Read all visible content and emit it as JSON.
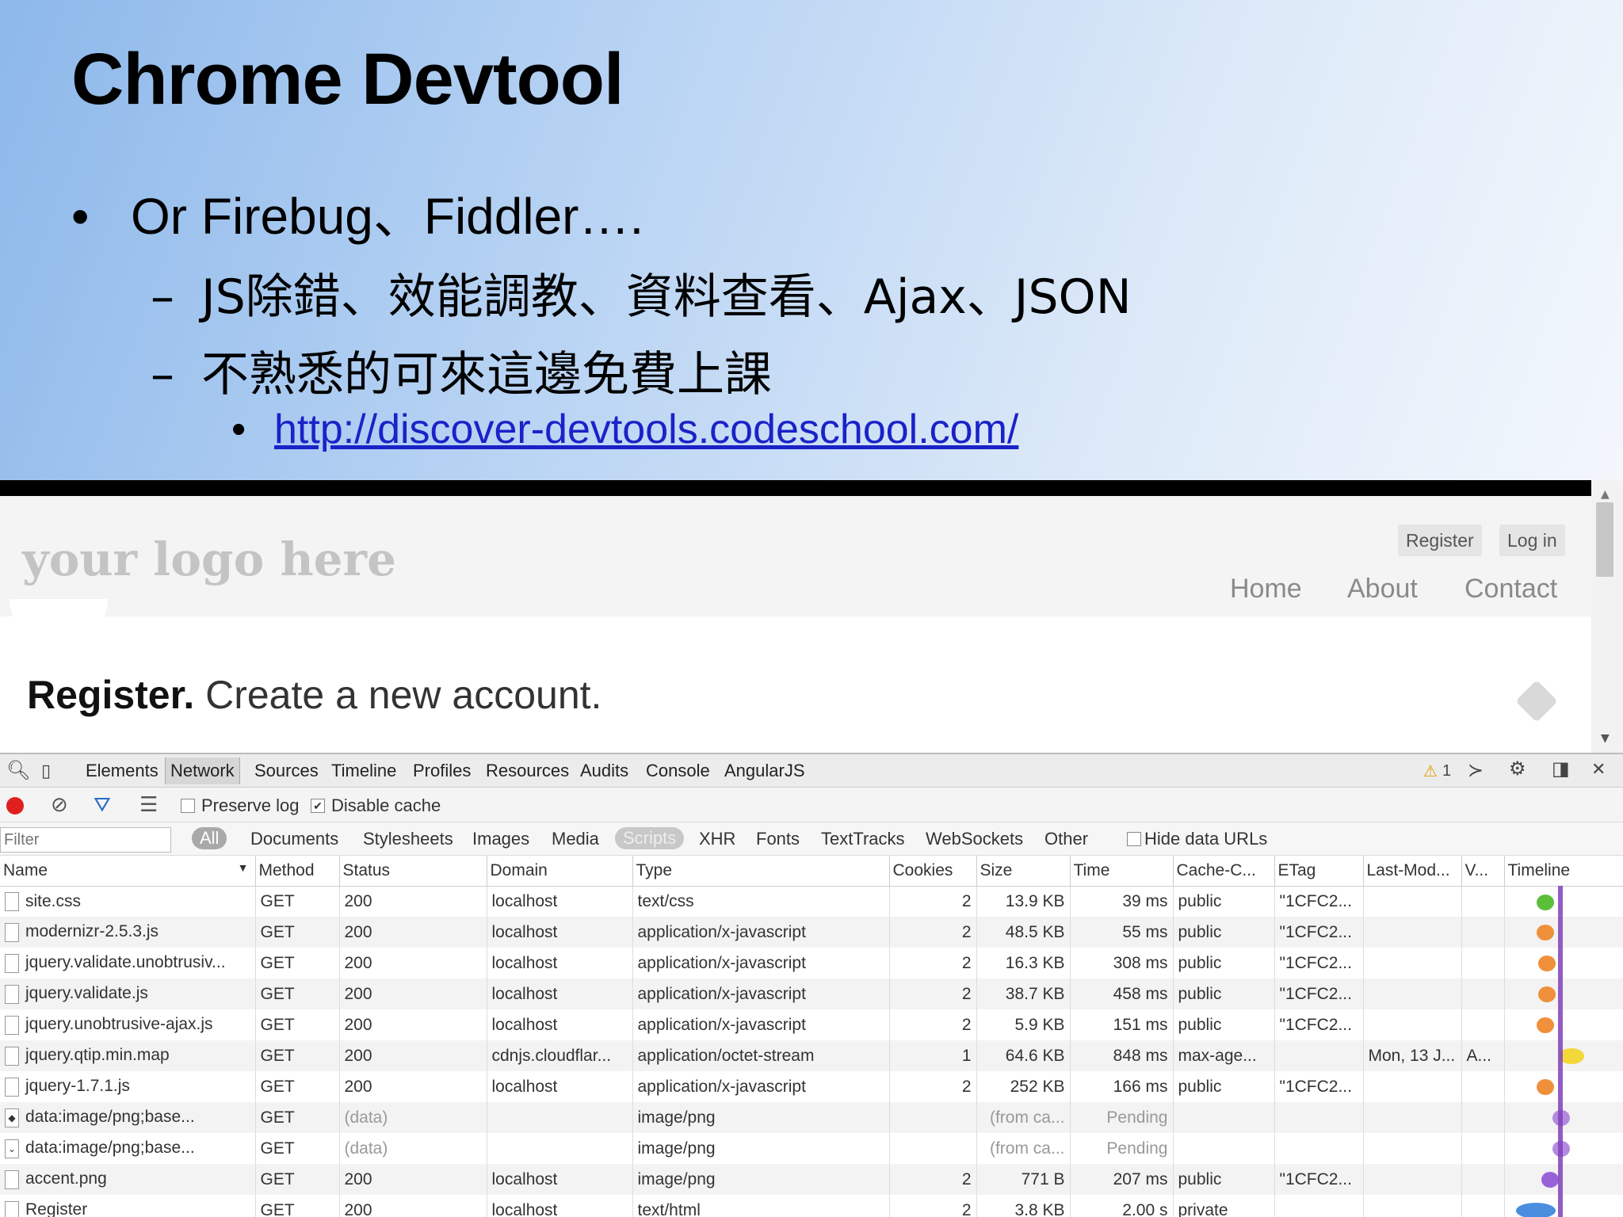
{
  "slide": {
    "title": "Chrome Devtool",
    "bullet1": "Or Firebug、Fiddler….",
    "bullet2": "JS除錯、效能調教、資料查看、Ajax、JSON",
    "bullet3": "不熟悉的可來這邊免費上課",
    "link": "http://discover-devtools.codeschool.com/",
    "bullet_symbol": "•",
    "dash_symbol": "–"
  },
  "site": {
    "logo": "your logo here",
    "register_button": "Register",
    "login_button": "Log in",
    "nav": [
      "Home",
      "About",
      "Contact"
    ],
    "heading_bold": "Register.",
    "heading_rest": " Create a new account."
  },
  "devtools": {
    "tabs": [
      "Elements",
      "Network",
      "Sources",
      "Timeline",
      "Profiles",
      "Resources",
      "Audits",
      "Console",
      "AngularJS"
    ],
    "active_tab": "Network",
    "warning_count": "1",
    "toolbar": {
      "preserve_log": "Preserve log",
      "disable_cache": "Disable cache",
      "preserve_checked": false,
      "disable_checked": true
    },
    "filter": {
      "placeholder": "Filter",
      "types": [
        "All",
        "Documents",
        "Stylesheets",
        "Images",
        "Media",
        "Scripts",
        "XHR",
        "Fonts",
        "TextTracks",
        "WebSockets",
        "Other"
      ],
      "hide_data_urls": "Hide data URLs"
    },
    "columns": [
      "Name",
      "Method",
      "Status",
      "Domain",
      "Type",
      "Cookies",
      "Size",
      "Time",
      "Cache-C...",
      "ETag",
      "Last-Mod...",
      "V...",
      "Timeline"
    ],
    "rows": [
      {
        "name": "site.css",
        "method": "GET",
        "status": "200",
        "domain": "localhost",
        "type": "text/css",
        "cookies": "2",
        "size": "13.9 KB",
        "time": "39 ms",
        "cache": "public",
        "etag": "\"1CFC2...",
        "lastmod": "",
        "v": "",
        "tl_color": "#5cbf3a"
      },
      {
        "name": "modernizr-2.5.3.js",
        "method": "GET",
        "status": "200",
        "domain": "localhost",
        "type": "application/x-javascript",
        "cookies": "2",
        "size": "48.5 KB",
        "time": "55 ms",
        "cache": "public",
        "etag": "\"1CFC2...",
        "lastmod": "",
        "v": "",
        "tl_color": "#f0903a"
      },
      {
        "name": "jquery.validate.unobtrusiv...",
        "method": "GET",
        "status": "200",
        "domain": "localhost",
        "type": "application/x-javascript",
        "cookies": "2",
        "size": "16.3 KB",
        "time": "308 ms",
        "cache": "public",
        "etag": "\"1CFC2...",
        "lastmod": "",
        "v": "",
        "tl_color": "#f0903a"
      },
      {
        "name": "jquery.validate.js",
        "method": "GET",
        "status": "200",
        "domain": "localhost",
        "type": "application/x-javascript",
        "cookies": "2",
        "size": "38.7 KB",
        "time": "458 ms",
        "cache": "public",
        "etag": "\"1CFC2...",
        "lastmod": "",
        "v": "",
        "tl_color": "#f0903a"
      },
      {
        "name": "jquery.unobtrusive-ajax.js",
        "method": "GET",
        "status": "200",
        "domain": "localhost",
        "type": "application/x-javascript",
        "cookies": "2",
        "size": "5.9 KB",
        "time": "151 ms",
        "cache": "public",
        "etag": "\"1CFC2...",
        "lastmod": "",
        "v": "",
        "tl_color": "#f0903a"
      },
      {
        "name": "jquery.qtip.min.map",
        "method": "GET",
        "status": "200",
        "domain": "cdnjs.cloudflar...",
        "type": "application/octet-stream",
        "cookies": "1",
        "size": "64.6 KB",
        "time": "848 ms",
        "cache": "max-age...",
        "etag": "",
        "lastmod": "Mon, 13 J...",
        "v": "A...",
        "tl_color": "#f2d83a"
      },
      {
        "name": "jquery-1.7.1.js",
        "method": "GET",
        "status": "200",
        "domain": "localhost",
        "type": "application/x-javascript",
        "cookies": "2",
        "size": "252 KB",
        "time": "166 ms",
        "cache": "public",
        "etag": "\"1CFC2...",
        "lastmod": "",
        "v": "",
        "tl_color": "#f0903a"
      },
      {
        "name": "data:image/png;base...",
        "method": "GET",
        "status": "(data)",
        "domain": "",
        "type": "image/png",
        "cookies": "",
        "size": "(from ca...",
        "time": "Pending",
        "cache": "",
        "etag": "",
        "lastmod": "",
        "v": "",
        "tl_color": "#b48ae0"
      },
      {
        "name": "data:image/png;base...",
        "method": "GET",
        "status": "(data)",
        "domain": "",
        "type": "image/png",
        "cookies": "",
        "size": "(from ca...",
        "time": "Pending",
        "cache": "",
        "etag": "",
        "lastmod": "",
        "v": "",
        "tl_color": "#b48ae0"
      },
      {
        "name": "accent.png",
        "method": "GET",
        "status": "200",
        "domain": "localhost",
        "type": "image/png",
        "cookies": "2",
        "size": "771 B",
        "time": "207 ms",
        "cache": "public",
        "etag": "\"1CFC2...",
        "lastmod": "",
        "v": "",
        "tl_color": "#9a62d8"
      },
      {
        "name": "Register",
        "method": "GET",
        "status": "200",
        "domain": "localhost",
        "type": "text/html",
        "cookies": "2",
        "size": "3.8 KB",
        "time": "2.00 s",
        "cache": "private",
        "etag": "",
        "lastmod": "",
        "v": "",
        "tl_color": "#4a8ee0"
      }
    ]
  }
}
